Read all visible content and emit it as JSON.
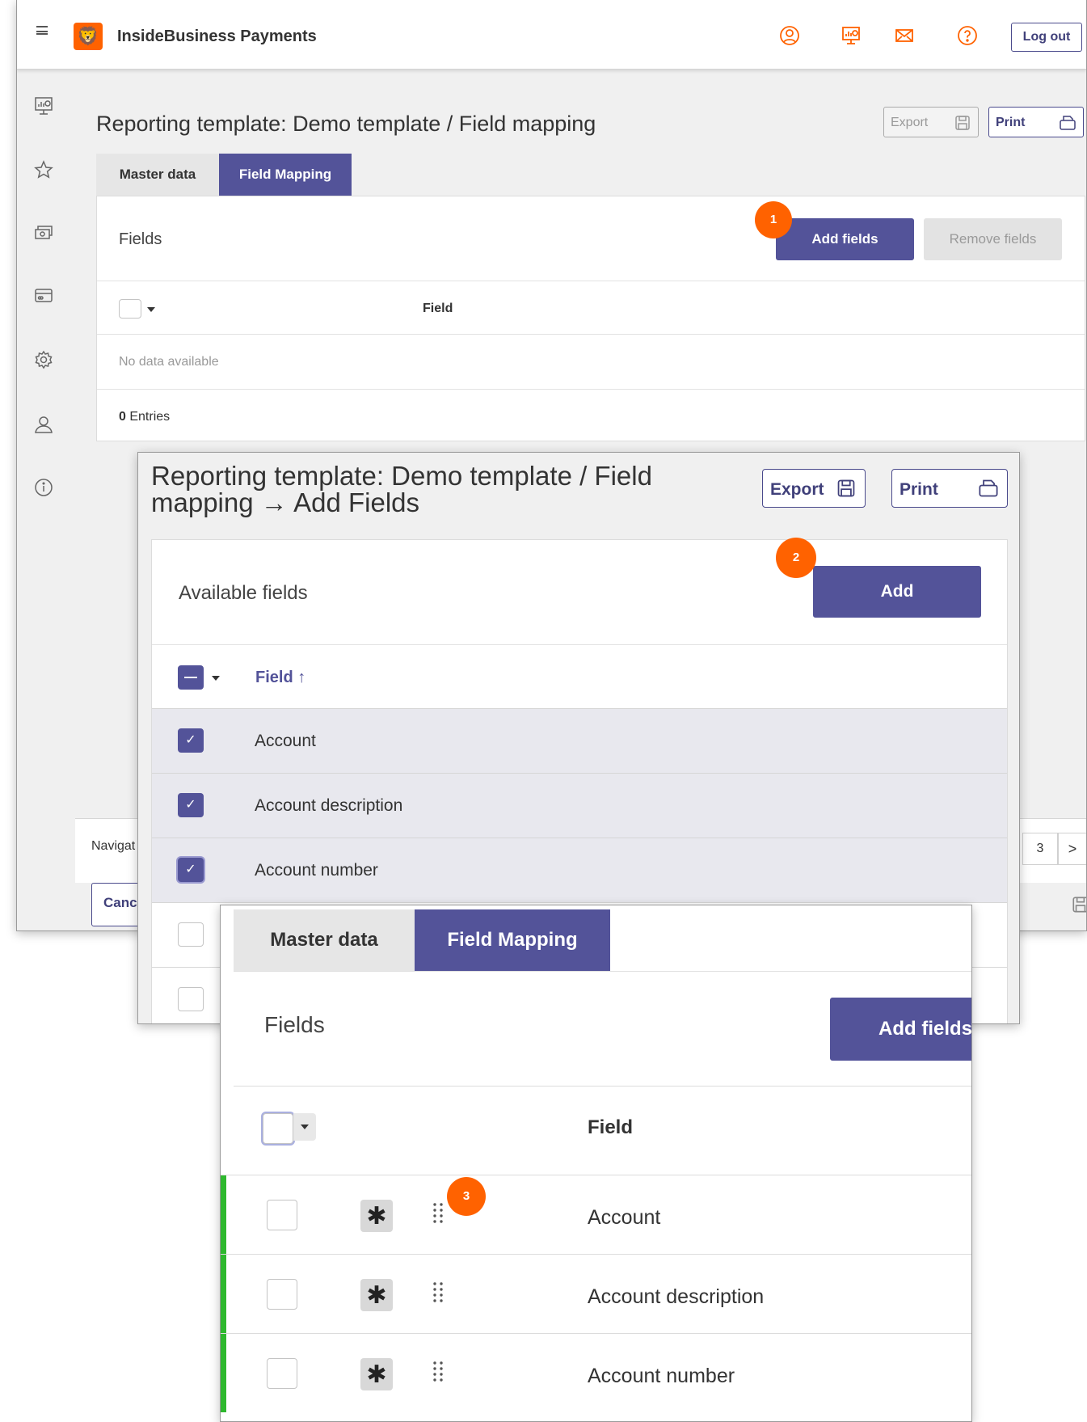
{
  "app": {
    "title": "InsideBusiness Payments",
    "logout": "Log out"
  },
  "topbar_icons": [
    "user-icon",
    "presentation-icon",
    "mail-icon",
    "help-icon"
  ],
  "sidebar_icons": [
    "presentation-icon",
    "star-icon",
    "cash-icon",
    "card-icon",
    "gear-icon",
    "user-icon",
    "info-icon"
  ],
  "page": {
    "title": "Reporting template: Demo template / Field mapping",
    "export": "Export",
    "print": "Print",
    "tabs": [
      "Master data",
      "Field Mapping"
    ],
    "fields_heading": "Fields",
    "add_fields": "Add fields",
    "remove_fields": "Remove fields",
    "column_field": "Field",
    "empty": "No data available",
    "entries_count": "0",
    "entries_label": "Entries",
    "footer_nav": "Navigat",
    "footer_cancel": "Cance",
    "page_number": "3",
    "next_arrow": ">"
  },
  "dialog": {
    "title": "Reporting template: Demo template / Field mapping → Add Fields",
    "export": "Export",
    "print": "Print",
    "available_fields": "Available fields",
    "add": "Add",
    "column_field": "Field ↑",
    "rows": [
      {
        "label": "Account",
        "checked": true
      },
      {
        "label": "Account description",
        "checked": true
      },
      {
        "label": "Account number",
        "checked": true
      }
    ]
  },
  "mapping": {
    "tabs": [
      "Master data",
      "Field Mapping"
    ],
    "fields_heading": "Fields",
    "add_fields": "Add fields",
    "column_field": "Field",
    "rows": [
      "Account",
      "Account description",
      "Account number"
    ]
  },
  "badges": [
    "1",
    "2",
    "3"
  ],
  "colors": {
    "primary": "#535399",
    "orange": "#ff6200",
    "green": "#2eb82e",
    "background": "#f0f0f0"
  }
}
